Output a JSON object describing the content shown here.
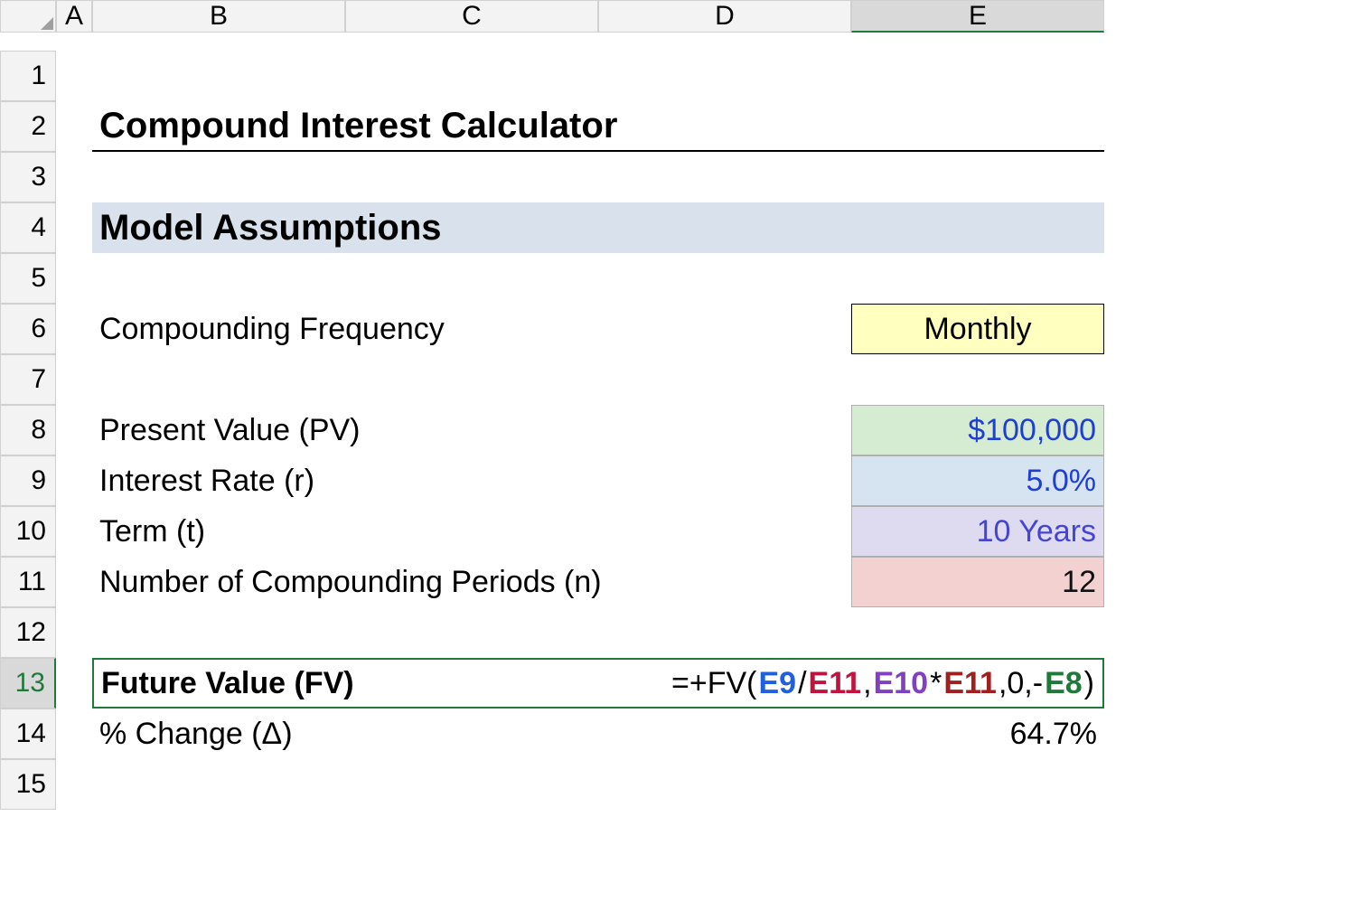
{
  "columns": [
    "A",
    "B",
    "C",
    "D",
    "E"
  ],
  "active_column": "E",
  "active_row": "13",
  "rows": [
    "1",
    "2",
    "3",
    "4",
    "5",
    "6",
    "7",
    "8",
    "9",
    "10",
    "11",
    "12",
    "13",
    "14",
    "15"
  ],
  "title": "Compound Interest Calculator",
  "section": "Model Assumptions",
  "labels": {
    "freq": "Compounding Frequency",
    "pv": "Present Value (PV)",
    "rate": "Interest Rate (r)",
    "term": "Term (t)",
    "n": "Number of Compounding Periods (n)",
    "fv": "Future Value (FV)",
    "change": "% Change (Δ)"
  },
  "values": {
    "freq": "Monthly",
    "pv": "$100,000",
    "rate": "5.0%",
    "term": "10 Years",
    "n": "12",
    "change": "64.7%"
  },
  "formula": {
    "prefix": "=+FV(",
    "p1": "E9",
    "op1": "/",
    "p2": "E11",
    "sep1": ",",
    "p3": "E10",
    "op2": "*",
    "p4": "E11",
    "sep2": ",0,-",
    "p5": "E8",
    "suffix": ")"
  }
}
